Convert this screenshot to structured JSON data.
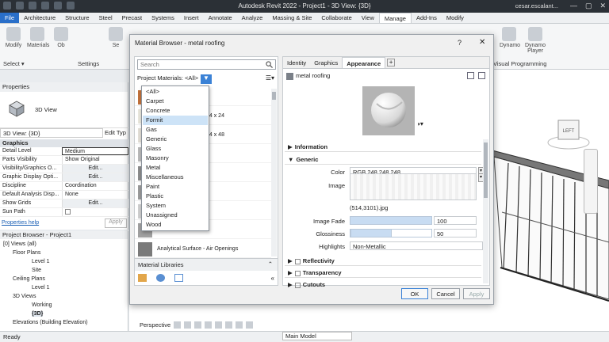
{
  "app": {
    "title": "Autodesk Revit 2022 - Project1 - 3D View: {3D}",
    "user": "cesar.escalant..."
  },
  "ribbon": {
    "tabs": [
      "File",
      "Architecture",
      "Structure",
      "Steel",
      "Precast",
      "Systems",
      "Insert",
      "Annotate",
      "Analyze",
      "Massing & Site",
      "Collaborate",
      "View",
      "Manage",
      "Add-Ins",
      "Modify"
    ],
    "active_tab": "Manage",
    "buttons": [
      "Modify",
      "Materials",
      "Ob",
      "Se"
    ],
    "groups": {
      "select": "Select ▾",
      "settings": "Settings",
      "visual": "Visual Programming",
      "dynamo": "Dynamo",
      "dynamo_player": "Dynamo Player"
    }
  },
  "properties": {
    "header": "Properties",
    "type_label": "3D View",
    "view_selector": "3D View: {3D}",
    "edit_type": "Edit Typ",
    "group": "Graphics",
    "rows": [
      {
        "name": "Detail Level",
        "value": "Medium"
      },
      {
        "name": "Parts Visibility",
        "value": "Show Original"
      },
      {
        "name": "Visibility/Graphics O...",
        "value": "Edit..."
      },
      {
        "name": "Graphic Display Opti...",
        "value": "Edit..."
      },
      {
        "name": "Discipline",
        "value": "Coordination"
      },
      {
        "name": "Default Analysis Disp...",
        "value": "None"
      },
      {
        "name": "Show Grids",
        "value": "Edit..."
      },
      {
        "name": "Sun Path",
        "value": ""
      }
    ],
    "help": "Properties help",
    "apply": "Apply"
  },
  "browser": {
    "header": "Project Browser - Project1",
    "nodes": [
      {
        "label": "[0] Views (all)",
        "indent": 0
      },
      {
        "label": "Floor Plans",
        "indent": 1
      },
      {
        "label": "Level 1",
        "indent": 2
      },
      {
        "label": "Site",
        "indent": 2
      },
      {
        "label": "Ceiling Plans",
        "indent": 1
      },
      {
        "label": "Level 1",
        "indent": 2
      },
      {
        "label": "3D Views",
        "indent": 1
      },
      {
        "label": "Working",
        "indent": 2
      },
      {
        "label": "{3D}",
        "indent": 2
      },
      {
        "label": "Elevations (Building Elevation)",
        "indent": 1
      }
    ]
  },
  "status": {
    "left": "Ready",
    "model": "Main Model"
  },
  "viewbar": {
    "label": "Perspective"
  },
  "dialog": {
    "title": "Material Browser - metal roofing",
    "help": "?",
    "close": "✕",
    "search_placeholder": "Search",
    "project_materials": "Project Materials: <All>",
    "materials_visible": [
      {
        "name": "",
        "color": "#c0703a"
      },
      {
        "name": "24 x 24",
        "color": "#e9e6dc"
      },
      {
        "name": "24 x 48",
        "color": "#e2dfd6"
      },
      {
        "name": "",
        "color": "#b9b9b9"
      },
      {
        "name": "",
        "color": "#8c8c8c"
      },
      {
        "name": "",
        "color": "#9a9a9a"
      },
      {
        "name": "",
        "color": "#cfcfcf"
      },
      {
        "name": "",
        "color": "#a0a0a0"
      },
      {
        "name": "Analytical Surface - Air Openings",
        "color": "#7a7a7a"
      }
    ],
    "filter_options": [
      "<All>",
      "Carpet",
      "Concrete",
      "Formit",
      "Gas",
      "Generic",
      "Glass",
      "Masonry",
      "Metal",
      "Miscellaneous",
      "Paint",
      "Plastic",
      "System",
      "Unassigned",
      "Wood"
    ],
    "filter_highlight": "Formit",
    "material_libraries": "Material Libraries",
    "right_tabs": [
      "Identity",
      "Graphics",
      "Appearance"
    ],
    "active_right_tab": "Appearance",
    "asset_name": "metal roofing",
    "sections": {
      "information": "Information",
      "generic": "Generic",
      "reflectivity": "Reflectivity",
      "transparency": "Transparency",
      "cutouts": "Cutouts"
    },
    "generic": {
      "color_label": "Color",
      "color_value": "RGB 248 248 248",
      "image_label": "Image",
      "image_name": "(514,3101).jpg",
      "fade_label": "Image Fade",
      "fade_value": "100",
      "fade_fill": 1.0,
      "gloss_label": "Glossiness",
      "gloss_value": "50",
      "gloss_fill": 0.5,
      "highlights_label": "Highlights",
      "highlights_value": "Non-Metallic"
    },
    "buttons": {
      "ok": "OK",
      "cancel": "Cancel",
      "apply": "Apply"
    }
  },
  "viewcube": {
    "label": "LEFT"
  },
  "colors": {
    "accent": "#3b82d6",
    "titlebar": "#2b3036",
    "file_tab": "#2a6fc9"
  }
}
